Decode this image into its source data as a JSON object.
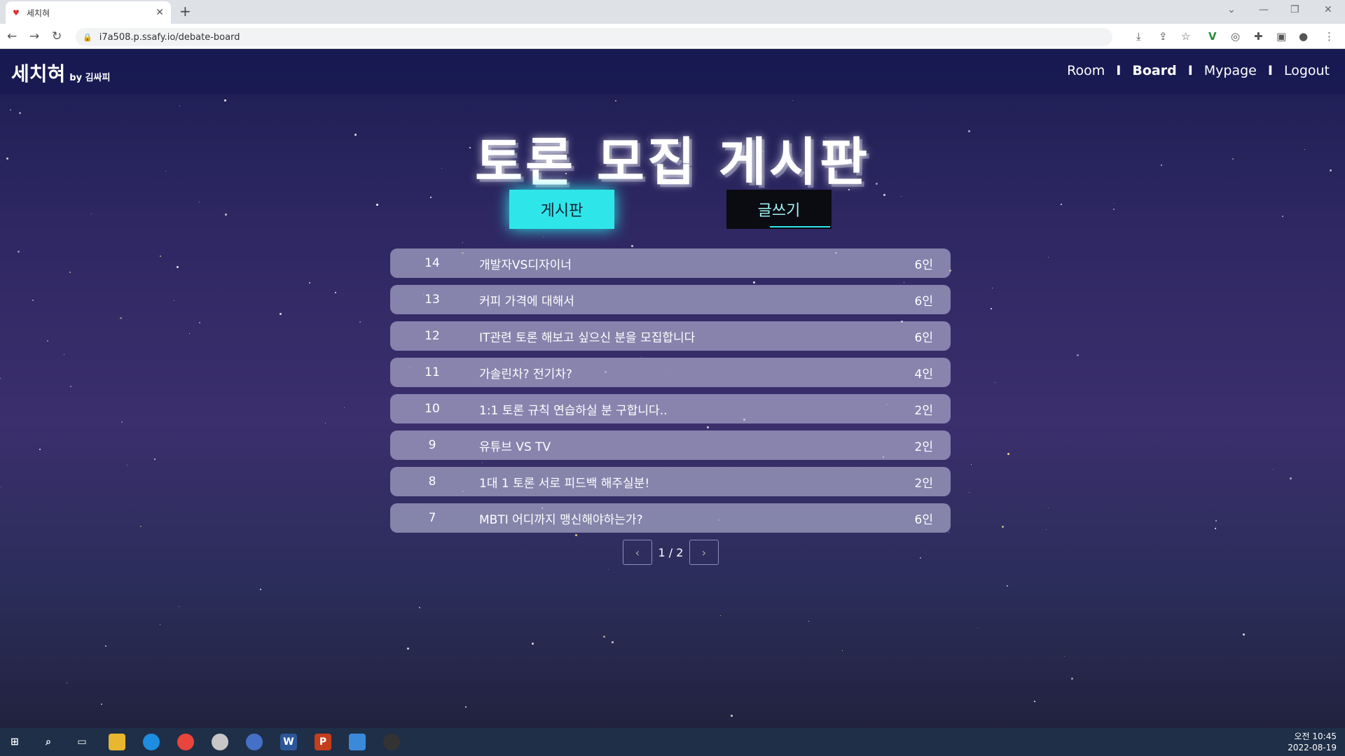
{
  "browser": {
    "tab_title": "세치혀",
    "url": "i7a508.p.ssafy.io/debate-board"
  },
  "header": {
    "logo": "세치혀",
    "logo_sub": "by 김싸피",
    "nav": [
      "Room",
      "Board",
      "Mypage",
      "Logout"
    ],
    "separator": "I",
    "active": "Board"
  },
  "main": {
    "title": "토론 모집 게시판",
    "board_button": "게시판",
    "write_button": "글쓰기"
  },
  "posts": [
    {
      "num": "14",
      "title": "개발자VS디자이너",
      "count": "6인"
    },
    {
      "num": "13",
      "title": "커피 가격에 대해서",
      "count": "6인"
    },
    {
      "num": "12",
      "title": "IT관련 토론 해보고 싶으신 분을 모집합니다",
      "count": "6인"
    },
    {
      "num": "11",
      "title": "가솔린차? 전기차?",
      "count": "4인"
    },
    {
      "num": "10",
      "title": "1:1 토론 규칙 연습하실 분 구합니다..",
      "count": "2인"
    },
    {
      "num": "9",
      "title": "유튜브 VS TV",
      "count": "2인"
    },
    {
      "num": "8",
      "title": "1대 1 토론 서로 피드백 해주실분!",
      "count": "2인"
    },
    {
      "num": "7",
      "title": "MBTI 어디까지 맹신해야하는가?",
      "count": "6인"
    }
  ],
  "pagination": {
    "prev": "‹",
    "next": "›",
    "text": "1 / 2"
  },
  "taskbar": {
    "time": "오전 10:45",
    "date": "2022-08-19"
  },
  "colors": {
    "accent": "#2ee6ea",
    "row_bg": "#b9b9d7"
  }
}
